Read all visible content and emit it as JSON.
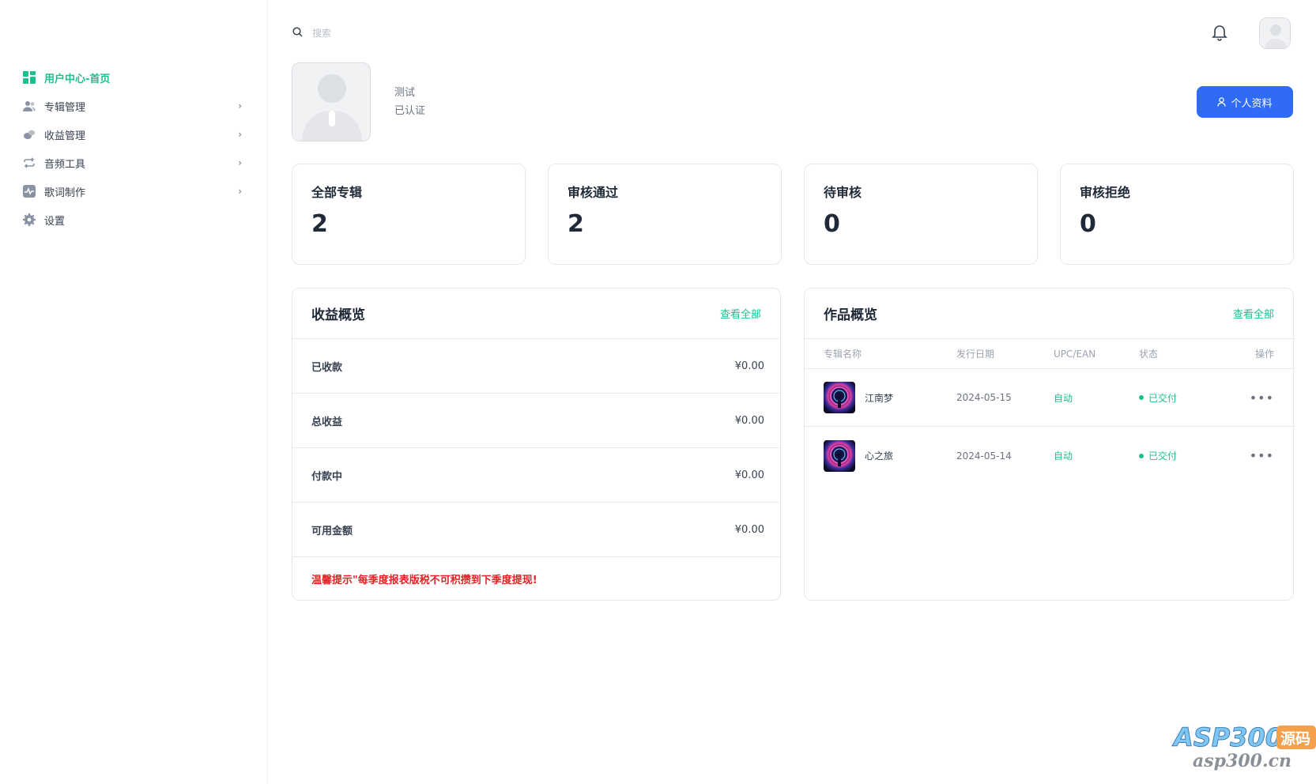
{
  "sidebar": {
    "items": [
      {
        "label": "用户中心-首页",
        "icon": "dashboard-grid-icon",
        "active": true
      },
      {
        "label": "专辑管理",
        "icon": "users-icon",
        "chevron": "›"
      },
      {
        "label": "收益管理",
        "icon": "coins-icon",
        "chevron": "›"
      },
      {
        "label": "音频工具",
        "icon": "repeat-icon",
        "chevron": "›"
      },
      {
        "label": "歌词制作",
        "icon": "activity-icon",
        "chevron": "›"
      },
      {
        "label": "设置",
        "icon": "gear-icon"
      }
    ]
  },
  "topbar": {
    "search_placeholder": "搜索"
  },
  "profile": {
    "name": "测试",
    "status": "已认证",
    "button_label": "个人资料"
  },
  "stats": [
    {
      "title": "全部专辑",
      "value": "2"
    },
    {
      "title": "审核通过",
      "value": "2"
    },
    {
      "title": "待审核",
      "value": "0"
    },
    {
      "title": "审核拒绝",
      "value": "0"
    }
  ],
  "income": {
    "title": "收益概览",
    "link": "查看全部",
    "rows": [
      {
        "label": "已收款",
        "amount": "¥0.00"
      },
      {
        "label": "总收益",
        "amount": "¥0.00"
      },
      {
        "label": "付款中",
        "amount": "¥0.00"
      },
      {
        "label": "可用金额",
        "amount": "¥0.00"
      }
    ],
    "tip": "温馨提示\"每季度报表版税不可积攒到下季度提现!"
  },
  "works": {
    "title": "作品概览",
    "link": "查看全部",
    "columns": [
      "专辑名称",
      "发行日期",
      "UPC/EAN",
      "状态",
      "操作"
    ],
    "rows": [
      {
        "name": "江南梦",
        "date": "2024-05-15",
        "upc": "自动",
        "status": "已交付",
        "action": "•••"
      },
      {
        "name": "心之旅",
        "date": "2024-05-14",
        "upc": "自动",
        "status": "已交付",
        "action": "•••"
      }
    ]
  },
  "watermark": {
    "brand": "ASP300",
    "badge": "源码",
    "domain": "asp300.cn"
  },
  "colors": {
    "accent": "#1ebf8f",
    "primary_button": "#2f6bf5",
    "warning_text": "#e02424"
  }
}
